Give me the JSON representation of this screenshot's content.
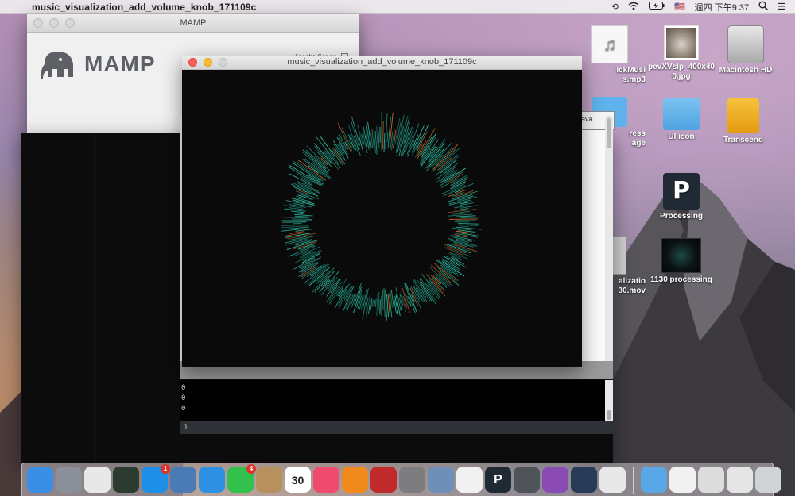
{
  "menubar": {
    "app_name": "music_visualization_add_volume_knob_171109c",
    "clock": "週四 下午9:37",
    "flag": "🇺🇸"
  },
  "desktop_icons": [
    {
      "label": "ickMusi\ns.mp3",
      "icon": "music-file-icon"
    },
    {
      "label": "pevXVslp_400x40\n0.jpg",
      "icon": "image-file-icon"
    },
    {
      "label": "Macintosh HD",
      "icon": "hard-drive-icon"
    },
    {
      "label": "ress\nage",
      "icon": "folder-icon"
    },
    {
      "label": "UI icon",
      "icon": "folder-icon"
    },
    {
      "label": "Transcend",
      "icon": "external-drive-icon"
    },
    {
      "label": "Processing",
      "icon": "processing-app-icon"
    },
    {
      "label": "alizatio\n30.mov",
      "icon": "movie-file-icon"
    },
    {
      "label": "1130 processing",
      "icon": "video-thumbnail-icon"
    }
  ],
  "mamp_window": {
    "title": "MAMP",
    "logo_text": "MAMP",
    "server_label": "Apache Server"
  },
  "sketch_window": {
    "title": "music_visualization_add_volume_knob_171109c"
  },
  "ide": {
    "dropdown_value": "ava",
    "console_lines": [
      "0",
      "0",
      "0"
    ],
    "status_line": "1"
  },
  "dock": {
    "items": [
      {
        "name": "finder",
        "icon": "finder-icon",
        "color": "#3a8ee6"
      },
      {
        "name": "launchpad",
        "icon": "rocket-icon",
        "color": "#8a8f99"
      },
      {
        "name": "chrome",
        "icon": "chrome-icon",
        "color": "#e8e8e8"
      },
      {
        "name": "dashboard",
        "icon": "dashboard-icon",
        "color": "#2b3b2f"
      },
      {
        "name": "app-store",
        "icon": "app-store-icon",
        "color": "#1d8fe8",
        "badge": "1"
      },
      {
        "name": "preview",
        "icon": "preview-icon",
        "color": "#4a7bb5"
      },
      {
        "name": "safari",
        "icon": "safari-icon",
        "color": "#2f8fe0"
      },
      {
        "name": "facetime",
        "icon": "facetime-icon",
        "color": "#33c14e",
        "badge": "4"
      },
      {
        "name": "contacts",
        "icon": "contacts-icon",
        "color": "#b8905e"
      },
      {
        "name": "calendar",
        "icon": "calendar-icon",
        "color": "#ffffff",
        "text": "30"
      },
      {
        "name": "itunes",
        "icon": "itunes-icon",
        "color": "#f04a6e"
      },
      {
        "name": "ibooks",
        "icon": "ibooks-icon",
        "color": "#f08a1c"
      },
      {
        "name": "photo-booth",
        "icon": "photo-booth-icon",
        "color": "#c02a2a"
      },
      {
        "name": "system-preferences",
        "icon": "gear-icon",
        "color": "#7d7d80"
      },
      {
        "name": "preview-2",
        "icon": "preview-icon",
        "color": "#6d8fb8"
      },
      {
        "name": "photos",
        "icon": "photos-icon",
        "color": "#f1f1f1"
      },
      {
        "name": "processing",
        "icon": "processing-app-icon",
        "color": "#1f2a35",
        "text": "P"
      },
      {
        "name": "mamp",
        "icon": "mamp-elephant-icon",
        "color": "#4e5459"
      },
      {
        "name": "github",
        "icon": "github-icon",
        "color": "#8a4bb5"
      },
      {
        "name": "quicktime",
        "icon": "quicktime-icon",
        "color": "#2a3b58"
      },
      {
        "name": "java",
        "icon": "java-icon",
        "color": "#e8e8e8"
      }
    ],
    "right_items": [
      {
        "name": "applications-folder",
        "icon": "folder-icon",
        "color": "#5aa7e8"
      },
      {
        "name": "documents",
        "icon": "document-icon",
        "color": "#f1f1f1"
      },
      {
        "name": "downloads",
        "icon": "download-stack-icon",
        "color": "#dcdcdc"
      },
      {
        "name": "screenshot-stack",
        "icon": "stack-icon",
        "color": "#e5e5e5"
      },
      {
        "name": "trash",
        "icon": "trash-icon",
        "color": "#cfd3d6"
      }
    ]
  }
}
